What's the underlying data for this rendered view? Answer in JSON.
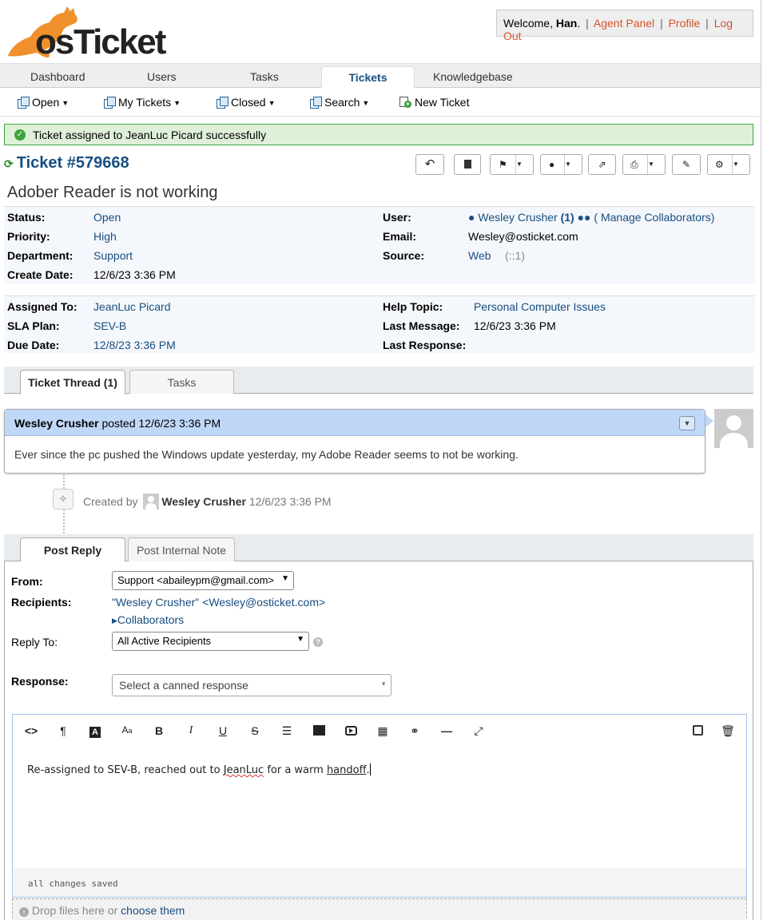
{
  "header": {
    "logo_text_os": "os",
    "logo_text_ticket": "Ticket",
    "welcome_prefix": "Welcome, ",
    "username": "Han",
    "welcome_suffix": ".",
    "sep": "|",
    "links": [
      "Agent Panel",
      "Profile",
      "Log Out"
    ]
  },
  "nav": {
    "tabs": [
      "Dashboard",
      "Users",
      "Tasks",
      "Tickets",
      "Knowledgebase"
    ],
    "active": "Tickets"
  },
  "subnav": {
    "items": [
      "Open",
      "My Tickets",
      "Closed",
      "Search",
      "New Ticket"
    ]
  },
  "message": {
    "text": "Ticket assigned to JeanLuc Picard successfully",
    "color": "#dff0d8"
  },
  "ticket": {
    "number": "Ticket #579668",
    "subject": "Adober Reader is not working"
  },
  "info1": {
    "status_label": "Status:",
    "status": "Open",
    "priority_label": "Priority:",
    "priority": "High",
    "department_label": "Department:",
    "department": "Support",
    "create_label": "Create Date:",
    "create": "12/6/23 3:36 PM",
    "user_label": "User:",
    "user": "Wesley Crusher",
    "user_count": "(1)",
    "manage": "( Manage Collaborators)",
    "email_label": "Email:",
    "email": "Wesley@osticket.com",
    "source_label": "Source:",
    "source": "Web",
    "source_ip": "(::1)"
  },
  "info2": {
    "assigned_label": "Assigned To:",
    "assigned": "JeanLuc Picard",
    "sla_label": "SLA Plan:",
    "sla": "SEV-B",
    "due_label": "Due Date:",
    "due": "12/8/23 3:36 PM",
    "topic_label": "Help Topic:",
    "topic": "Personal Computer Issues",
    "lastmsg_label": "Last Message:",
    "lastmsg": "12/6/23 3:36 PM",
    "lastresp_label": "Last Response:",
    "lastresp": ""
  },
  "thread_tabs": [
    "Ticket Thread (1)",
    "Tasks"
  ],
  "entry": {
    "author": "Wesley Crusher",
    "posted": "posted 12/6/23 3:36 PM",
    "body": "Ever since the pc pushed the Windows update yesterday, my Adobe Reader seems to not be working."
  },
  "event": {
    "prefix": "Created by",
    "who": "Wesley Crusher",
    "when": "12/6/23 3:36 PM"
  },
  "reply_tabs": [
    "Post Reply",
    "Post Internal Note"
  ],
  "reply": {
    "from_label": "From:",
    "from_value": "Support <abaileypm@gmail.com>",
    "recipients_label": "Recipients:",
    "recipients_value": "\"Wesley Crusher\" <Wesley@osticket.com>",
    "collaborators": "Collaborators",
    "replyto_label": "Reply To:",
    "replyto_value": "All Active Recipients",
    "response_label": "Response:",
    "response_placeholder": "Select a canned response"
  },
  "editor": {
    "text_a": "Re-assigned to SEV-B, reached out to ",
    "text_b": "JeanLuc",
    "text_c": " for a warm ",
    "text_d": "handoff",
    "text_e": ".",
    "status": "all changes saved",
    "tools": [
      "code-view-icon",
      "paragraph-icon",
      "text-color-icon",
      "font-size-icon",
      "bold-icon",
      "italic-icon",
      "underline-icon",
      "strikethrough-icon",
      "list-icon",
      "image-icon",
      "video-icon",
      "table-icon",
      "link-icon",
      "horizontal-rule-icon",
      "fullscreen-icon",
      "save-draft-icon",
      "delete-draft-icon"
    ]
  },
  "dropzone": {
    "text": "Drop files here or",
    "link": "choose them"
  }
}
